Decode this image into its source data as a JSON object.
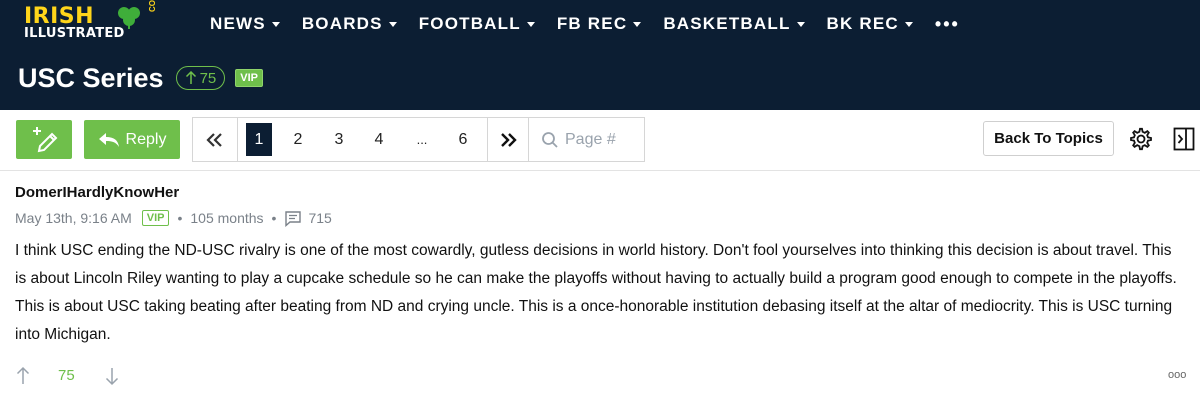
{
  "brand": {
    "line1": "IRISH",
    "line2": "ILLUSTRATED",
    "suffix": "COM",
    "logo_icon": "shamrock-icon"
  },
  "nav": {
    "items": [
      {
        "label": "NEWS"
      },
      {
        "label": "BOARDS"
      },
      {
        "label": "FOOTBALL"
      },
      {
        "label": "FB REC"
      },
      {
        "label": "BASKETBALL"
      },
      {
        "label": "BK REC"
      }
    ],
    "more_label": "•••"
  },
  "thread": {
    "title": "USC Series",
    "votes": "75",
    "vote_icon": "arrow-up-icon",
    "badge": "VIP"
  },
  "toolbar": {
    "new_topic_icon": "new-post-icon",
    "reply_label": "Reply",
    "back_label": "Back To Topics",
    "settings_icon": "gear-icon",
    "sidebar_icon": "sidebar-toggle-icon"
  },
  "pagination": {
    "first_icon": "double-chevron-left-icon",
    "pages": [
      "1",
      "2",
      "3",
      "4",
      "...",
      "6"
    ],
    "current": "1",
    "next_icon": "double-chevron-right-icon",
    "input_placeholder": "Page #"
  },
  "post": {
    "author": "DomerIHardlyKnowHer",
    "date": "May 13th, 9:16 AM",
    "badge": "VIP",
    "tenure": "105 months",
    "post_count": "715",
    "body": "I think USC ending the ND-USC rivalry is one of the most cowardly, gutless decisions in world history. Don't fool yourselves into thinking this decision is about travel. This is about Lincoln Riley wanting to play a cupcake schedule so he can make the playoffs without having to actually build a program good enough to compete in the playoffs. This is about USC taking beating after beating from ND and crying uncle. This is a once-honorable institution debasing itself at the altar of mediocrity. This is USC turning into Michigan.",
    "score": "75",
    "more_label": "ooo"
  },
  "colors": {
    "navy": "#0c1e33",
    "green": "#6fbf4b",
    "gold": "#ffd51a"
  }
}
